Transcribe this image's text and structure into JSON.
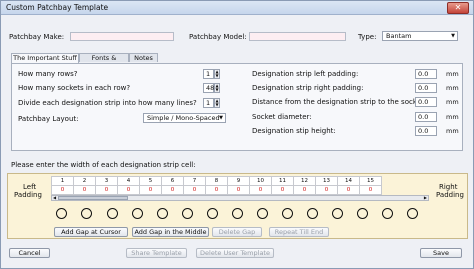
{
  "window": {
    "title": "Custom Patchbay Template",
    "close_glyph": "✕"
  },
  "header": {
    "make_label": "Patchbay Make:",
    "make_value": "",
    "model_label": "Patchbay Model:",
    "model_value": "",
    "type_label": "Type:",
    "type_value": "Bantam"
  },
  "tabs": [
    "The Important Stuff",
    "Fonts & Picture",
    "Notes"
  ],
  "left_fields": {
    "rows_label": "How many rows?",
    "rows_value": "1",
    "sockets_label": "How many sockets in each row?",
    "sockets_value": "48",
    "divide_label": "Divide each designation strip into how many lines?",
    "divide_value": "1",
    "layout_label": "Patchbay Layout:",
    "layout_value": "Simple / Mono-Spaced"
  },
  "right_fields": [
    {
      "label": "Designation strip left padding:",
      "value": "0.0",
      "unit": "mm"
    },
    {
      "label": "Designation strip right padding:",
      "value": "0.0",
      "unit": "mm"
    },
    {
      "label": "Distance from the designation strip to the socket:",
      "value": "0.0",
      "unit": "mm"
    },
    {
      "label": "Socket diameter:",
      "value": "0.0",
      "unit": "mm"
    },
    {
      "label": "Designation stip height:",
      "value": "0.0",
      "unit": "mm"
    }
  ],
  "cell_prompt": "Please enter the width of each designation strip cell:",
  "strip": {
    "left_label_1": "Left",
    "left_label_2": "Padding",
    "right_label_1": "Right",
    "right_label_2": "Padding",
    "columns": [
      "1",
      "2",
      "3",
      "4",
      "5",
      "6",
      "7",
      "8",
      "9",
      "10",
      "11",
      "12",
      "13",
      "14",
      "15"
    ],
    "values": [
      "0",
      "0",
      "0",
      "0",
      "0",
      "0",
      "0",
      "0",
      "0",
      "0",
      "0",
      "0",
      "0",
      "0",
      "0"
    ]
  },
  "gap_buttons": {
    "add_cursor": "Add Gap at Cursor",
    "add_middle": "Add Gap in the Middle",
    "delete": "Delete Gap",
    "repeat": "Repeat Till End"
  },
  "footer": {
    "cancel": "Cancel",
    "share": "Share Template",
    "delete_user": "Delete User Template",
    "save": "Save"
  },
  "colors": {
    "accent_value": "#d01010",
    "strip_background": "#fbf3d8",
    "input_tint": "#fdeef2"
  }
}
